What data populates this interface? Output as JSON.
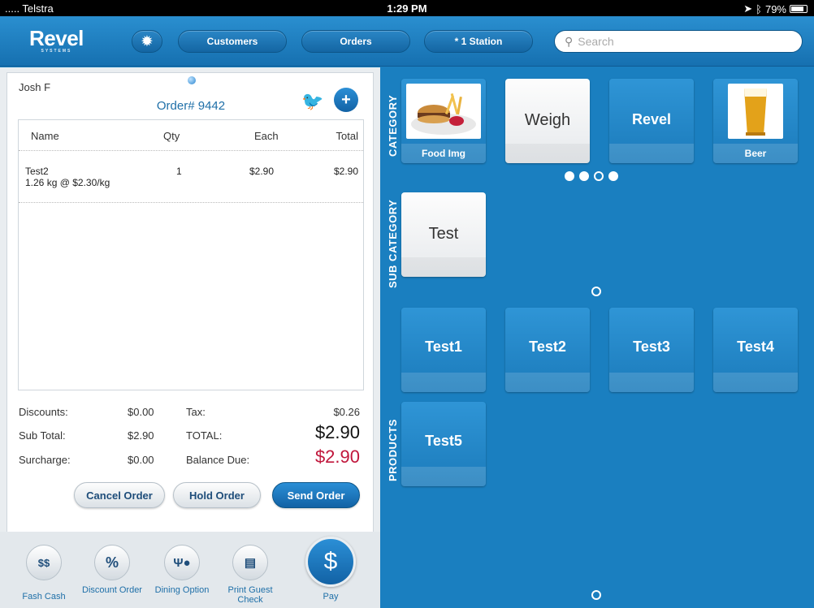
{
  "status": {
    "carrier": "..... Telstra",
    "time": "1:29 PM",
    "battery": "79%"
  },
  "header": {
    "logo": "Revel",
    "logo_sub": "SYSTEMS",
    "customers": "Customers",
    "orders": "Orders",
    "station": "* 1 Station",
    "search_placeholder": "Search"
  },
  "order": {
    "customer": "Josh F",
    "number": "Order# 9442",
    "columns": {
      "name": "Name",
      "qty": "Qty",
      "each": "Each",
      "total": "Total"
    },
    "items": [
      {
        "name": "Test2",
        "detail": "1.26 kg @ $2.30/kg",
        "qty": "1",
        "each": "$2.90",
        "total": "$2.90"
      }
    ]
  },
  "totals": {
    "discounts_label": "Discounts:",
    "discounts": "$0.00",
    "subtotal_label": "Sub Total:",
    "subtotal": "$2.90",
    "surcharge_label": "Surcharge:",
    "surcharge": "$0.00",
    "tax_label": "Tax:",
    "tax": "$0.26",
    "total_label": "TOTAL:",
    "total": "$2.90",
    "balance_label": "Balance Due:",
    "balance": "$2.90"
  },
  "actions": {
    "cancel": "Cancel Order",
    "hold": "Hold Order",
    "send": "Send Order"
  },
  "bottom": {
    "fash_cash": "Fash Cash",
    "discount": "Discount Order",
    "dining": "Dining Option",
    "print": "Print Guest Check",
    "pay": "Pay"
  },
  "sections": {
    "category": "CATEGORY",
    "subcategory": "SUB CATEGORY",
    "products": "PRODUCTS"
  },
  "categories": [
    {
      "label": "Food Img"
    },
    {
      "label": "Weigh"
    },
    {
      "label": "Revel"
    },
    {
      "label": "Beer"
    }
  ],
  "subcategories": [
    {
      "label": "Test"
    }
  ],
  "products": [
    {
      "label": "Test1"
    },
    {
      "label": "Test2"
    },
    {
      "label": "Test3"
    },
    {
      "label": "Test4"
    },
    {
      "label": "Test5"
    }
  ],
  "colors": {
    "accent": "#1a7fc0",
    "balance_red": "#c0163b"
  }
}
